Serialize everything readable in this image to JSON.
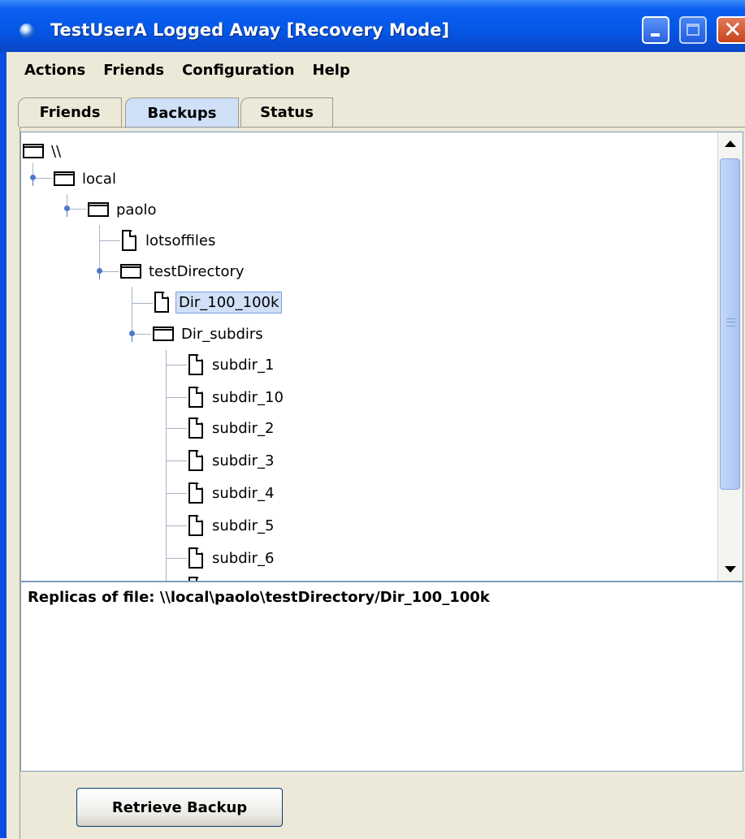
{
  "window": {
    "title": "TestUserA Logged Away [Recovery Mode]"
  },
  "menu": [
    "Actions",
    "Friends",
    "Configuration",
    "Help"
  ],
  "tabs": [
    {
      "label": "Friends",
      "active": false
    },
    {
      "label": "Backups",
      "active": true
    },
    {
      "label": "Status",
      "active": false
    }
  ],
  "tree": {
    "root": "\\\\",
    "nodes": [
      {
        "label": "local",
        "type": "folder"
      },
      {
        "label": "paolo",
        "type": "folder"
      },
      {
        "label": "lotsoffiles",
        "type": "file"
      },
      {
        "label": "testDirectory",
        "type": "folder"
      },
      {
        "label": "Dir_100_100k",
        "type": "file",
        "selected": true
      },
      {
        "label": "Dir_subdirs",
        "type": "folder"
      },
      {
        "label": "subdir_1",
        "type": "file"
      },
      {
        "label": "subdir_10",
        "type": "file"
      },
      {
        "label": "subdir_2",
        "type": "file"
      },
      {
        "label": "subdir_3",
        "type": "file"
      },
      {
        "label": "subdir_4",
        "type": "file"
      },
      {
        "label": "subdir_5",
        "type": "file"
      },
      {
        "label": "subdir_6",
        "type": "file"
      }
    ]
  },
  "replicas": {
    "text": "Replicas of file: \\\\local\\paolo\\testDirectory/Dir_100_100k"
  },
  "retrieve_button": "Retrieve Backup",
  "colors": {
    "titlebar": "#0456e6",
    "selection": "#cfe0f7",
    "window_bg": "#ece9d8"
  }
}
